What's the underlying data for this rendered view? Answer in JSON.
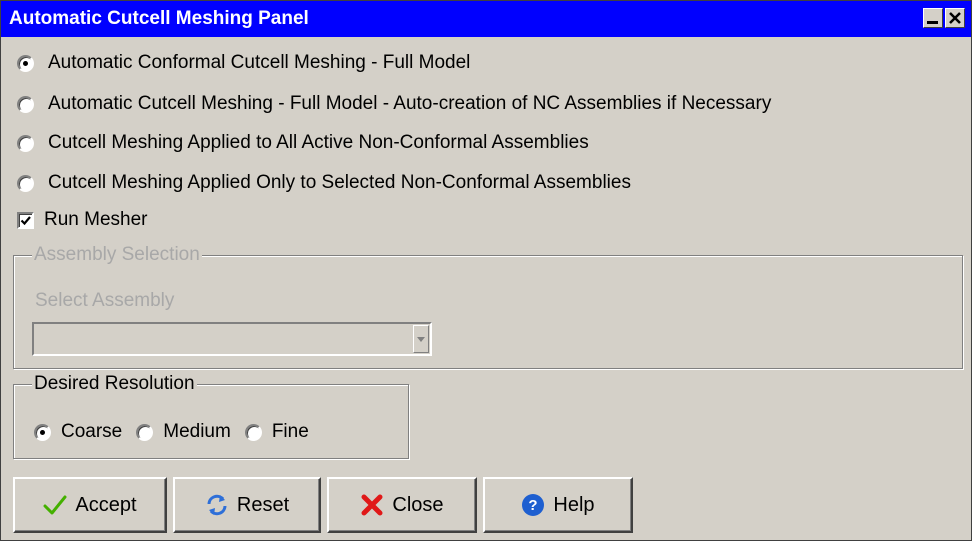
{
  "window": {
    "title": "Automatic Cutcell Meshing Panel",
    "minimize_icon": "minimize-icon",
    "close_icon": "close-icon"
  },
  "mesh_options": [
    {
      "label": "Automatic Conformal Cutcell Meshing - Full Model",
      "checked": true
    },
    {
      "label": "Automatic Cutcell Meshing - Full Model - Auto-creation of NC Assemblies if Necessary",
      "checked": false
    },
    {
      "label": "Cutcell Meshing Applied to All Active Non-Conformal Assemblies",
      "checked": false
    },
    {
      "label": "Cutcell Meshing Applied Only to Selected Non-Conformal Assemblies",
      "checked": false
    }
  ],
  "run_mesher": {
    "label": "Run Mesher",
    "checked": true
  },
  "assembly_selection": {
    "legend": "Assembly Selection",
    "select_label": "Select Assembly",
    "selected_value": ""
  },
  "resolution": {
    "legend": "Desired Resolution",
    "options": [
      {
        "label": "Coarse",
        "checked": true
      },
      {
        "label": "Medium",
        "checked": false
      },
      {
        "label": "Fine",
        "checked": false
      }
    ]
  },
  "buttons": {
    "accept": "Accept",
    "reset": "Reset",
    "close": "Close",
    "help": "Help"
  },
  "colors": {
    "titlebar": "#0000ff",
    "face": "#d4d0c8",
    "disabled_text": "#a8a8a8"
  }
}
